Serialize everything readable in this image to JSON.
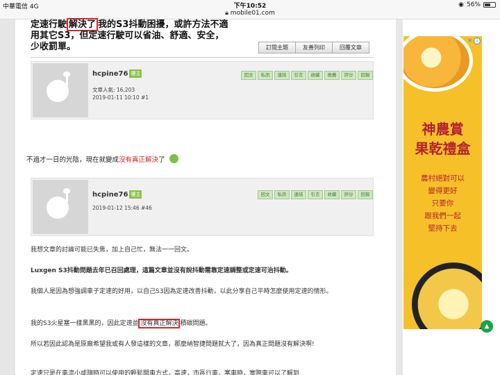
{
  "status_bar": {
    "carrier": "中華電信  4G",
    "time": "下午10:52",
    "url": "mobile01.com",
    "battery": "56%"
  },
  "post1_tail": {
    "line1_a": "定速行駛",
    "line1_box": "解決了",
    "line1_b": "我的S3抖動困擾，或許方法不適",
    "line2": "用其它S3，但定速行駛可以省油、舒適、安全，",
    "line3": "少收罰單。"
  },
  "toolbar": {
    "buttons": [
      "訂閱主題",
      "友善列印",
      "回覆文章"
    ]
  },
  "post1": {
    "username": "hcpine76",
    "role_tag": "樓主",
    "popularity": "文章人氣: 16,203",
    "date": "2019-01-11 10:10  #1",
    "actions": [
      "回文",
      "私訊",
      "連結",
      "引言",
      "收藏",
      "推薦",
      "評分",
      "回報"
    ]
  },
  "interlude": {
    "text_a": "不過才一日的光陰，現在就變成",
    "text_red": "沒有真正解決",
    "text_b": "了"
  },
  "post2": {
    "username": "hcpine76",
    "role_tag": "樓主",
    "date": "2019-01-12 15:46  #46",
    "actions": [
      "回文",
      "私訊",
      "連結",
      "引言",
      "收藏",
      "評分",
      "回報"
    ]
  },
  "body": {
    "p1": "我想文章的討論可能已失焦，加上自己忙，無法一一回文。",
    "p2": "Luxgen S3抖動問題去年已召回處理，這篇文章並沒有說抖動需靠定速調整或定速可治抖動。",
    "p3": "我個人是因為想強調車子定速的好用，以自己S3因為定速改善抖動，以此分享自己平時怎麼使用定速的情形。",
    "p4_a": "我的S3火星塞一樣黑黑的，因此定速並",
    "p4_box": "沒有真正解決",
    "p4_b": "積碳問題。",
    "p5": "所以若因此認為是原廠希望我或有人發這樣的文章，那麼納智捷問題就大了，因為真正問題沒有解決啊!",
    "p6": "定速只是在車流小或隨時可以使用的輕鬆開車方式，高速，市區行車，塞車時，實際車可以了解到"
  },
  "ad": {
    "title_line1": "神農賞",
    "title_line2": "果乾禮盒",
    "copy_lines": [
      "農村絕對可以",
      "變得更好",
      "只要你",
      "跟我們一起",
      "堅持下去"
    ],
    "badge": "i",
    "close": "✕"
  },
  "colors": {
    "highlight_red": "#d62828",
    "accent_green": "#1aa34a",
    "ad_yellow": "#f6c128"
  }
}
